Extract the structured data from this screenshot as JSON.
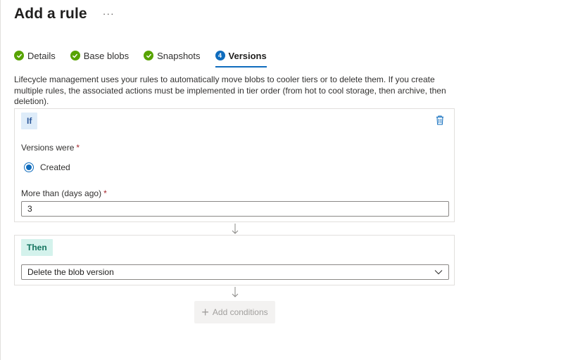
{
  "header": {
    "title": "Add a rule",
    "more_label": "···"
  },
  "tabs": [
    {
      "label": "Details",
      "state": "done"
    },
    {
      "label": "Base blobs",
      "state": "done"
    },
    {
      "label": "Snapshots",
      "state": "done"
    },
    {
      "label": "Versions",
      "state": "active",
      "step_number": "4"
    }
  ],
  "description": "Lifecycle management uses your rules to automatically move blobs to cooler tiers or to delete them. If you create multiple rules, the associated actions must be implemented in tier order (from hot to cool storage, then archive, then deletion).",
  "if_block": {
    "badge": "If",
    "versions_label": "Versions were",
    "required_mark": "*",
    "radio_option": "Created",
    "radio_selected": true,
    "days_label": "More than (days ago)",
    "days_value": "3",
    "delete_icon": "trash-icon"
  },
  "then_block": {
    "badge": "Then",
    "action_value": "Delete the blob version"
  },
  "add_conditions": {
    "label": "Add conditions",
    "enabled": false
  },
  "colors": {
    "accent": "#0f6cbd",
    "done": "#57a300",
    "if_badge_bg": "#deecf9",
    "then_badge_bg": "#d4f2ec"
  }
}
